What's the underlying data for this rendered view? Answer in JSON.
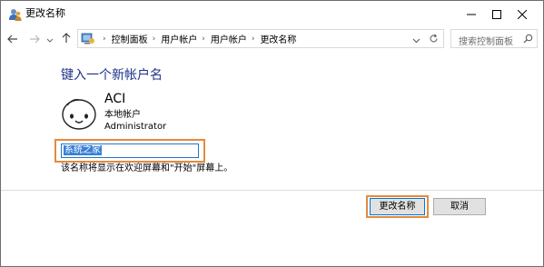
{
  "window": {
    "title": "更改名称",
    "title_icon": "users-control-panel-icon",
    "controls": [
      "minimize-icon",
      "maximize-icon",
      "close-icon"
    ]
  },
  "nav": {
    "back_icon": "back-arrow-icon",
    "forward_icon": "forward-arrow-icon",
    "history_icon": "chevron-down-icon",
    "up_icon": "up-arrow-icon"
  },
  "address": {
    "icon": "control-panel-icon",
    "crumbs": [
      "控制面板",
      "用户帐户",
      "用户帐户",
      "更改名称"
    ],
    "dropdown_icon": "chevron-down-icon",
    "refresh_icon": "refresh-icon"
  },
  "search": {
    "placeholder": "搜索控制面板",
    "icon": "search-icon"
  },
  "content": {
    "heading": "键入一个新帐户名",
    "account_name": "ACI",
    "account_type": "本地帐户",
    "account_role": "Administrator",
    "new_name_value": "系统之家",
    "hint": "该名称将显示在欢迎屏幕和\"开始\"屏幕上。"
  },
  "buttons": {
    "rename": "更改名称",
    "cancel": "取消"
  },
  "colors": {
    "heading": "#1e3287",
    "highlight": "#e58a3c",
    "selection": "#3a7fd6"
  }
}
